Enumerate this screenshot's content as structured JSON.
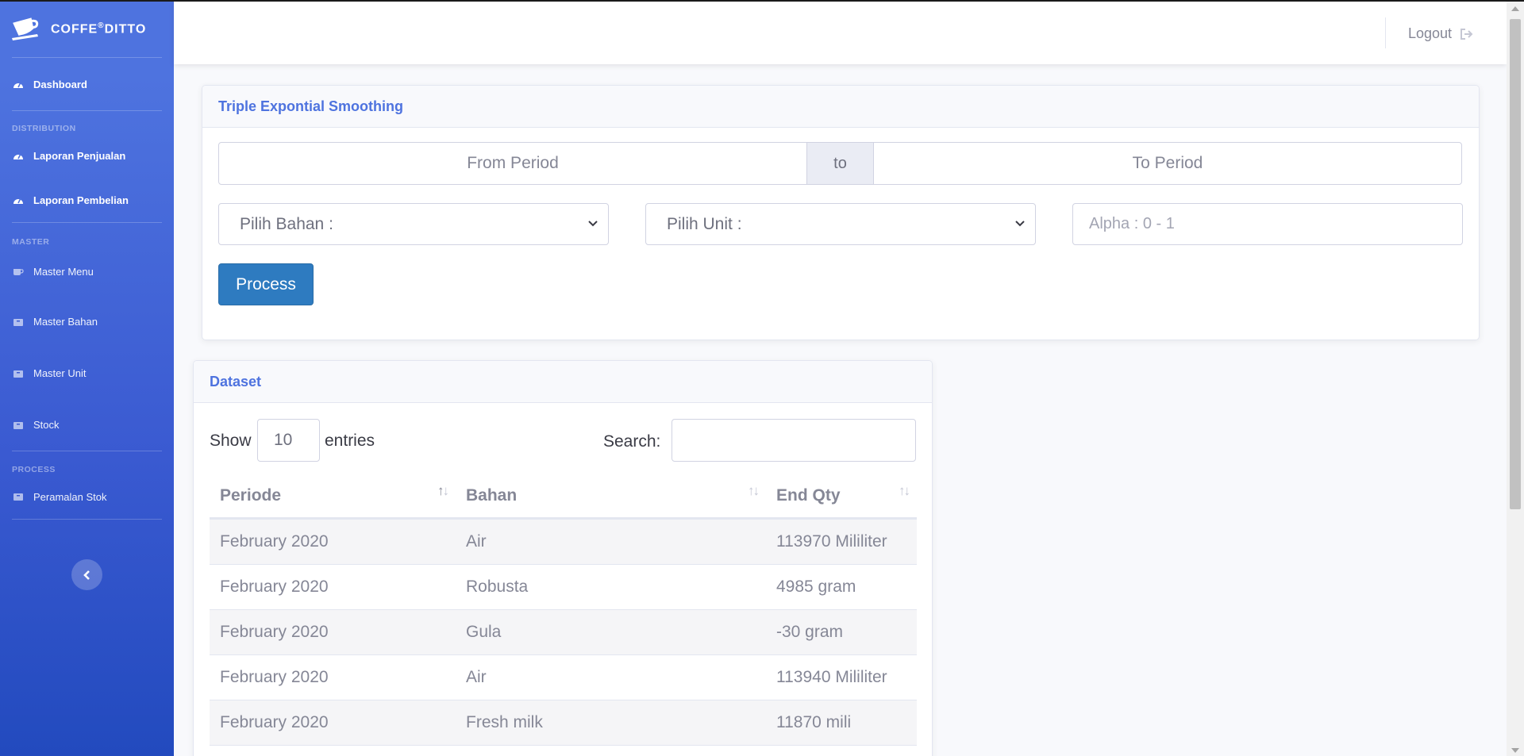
{
  "brand": {
    "name": "COFFE",
    "reg": "®",
    "name2": "DITTO"
  },
  "sidebar": {
    "dashboard": "Dashboard",
    "heading_distribution": "DISTRIBUTION",
    "laporan_penjualan": "Laporan Penjualan",
    "laporan_pembelian": "Laporan Pembelian",
    "heading_master": "MASTER",
    "master_menu": "Master Menu",
    "master_bahan": "Master Bahan",
    "master_unit": "Master Unit",
    "stock": "Stock",
    "heading_process": "PROCESS",
    "peramalan_stok": "Peramalan Stok",
    "toggle_icon": "chevron-left-icon"
  },
  "topbar": {
    "logout_label": "Logout",
    "logout_icon": "sign-out-icon"
  },
  "forecast": {
    "title": "Triple Expontial Smoothing",
    "from_placeholder": "From Period",
    "to_label": "to",
    "to_placeholder": "To Period",
    "bahan_select": "Pilih Bahan :",
    "unit_select": "Pilih Unit :",
    "alpha_placeholder": "Alpha : 0 - 1",
    "process_label": "Process"
  },
  "dataset": {
    "title": "Dataset",
    "show_label": "Show",
    "length_value": "10",
    "entries_label": "entries",
    "search_label": "Search:",
    "columns": [
      "Periode",
      "Bahan",
      "End Qty"
    ],
    "rows": [
      [
        "February 2020",
        "Air",
        "113970 Mililiter"
      ],
      [
        "February 2020",
        "Robusta",
        "4985 gram"
      ],
      [
        "February 2020",
        "Gula",
        "-30 gram"
      ],
      [
        "February 2020",
        "Air",
        "113940 Mililiter"
      ],
      [
        "February 2020",
        "Fresh milk",
        "11870 mili"
      ]
    ]
  },
  "colors": {
    "primary": "#4e73df",
    "button": "#2e7bc0",
    "text": "#858796"
  }
}
